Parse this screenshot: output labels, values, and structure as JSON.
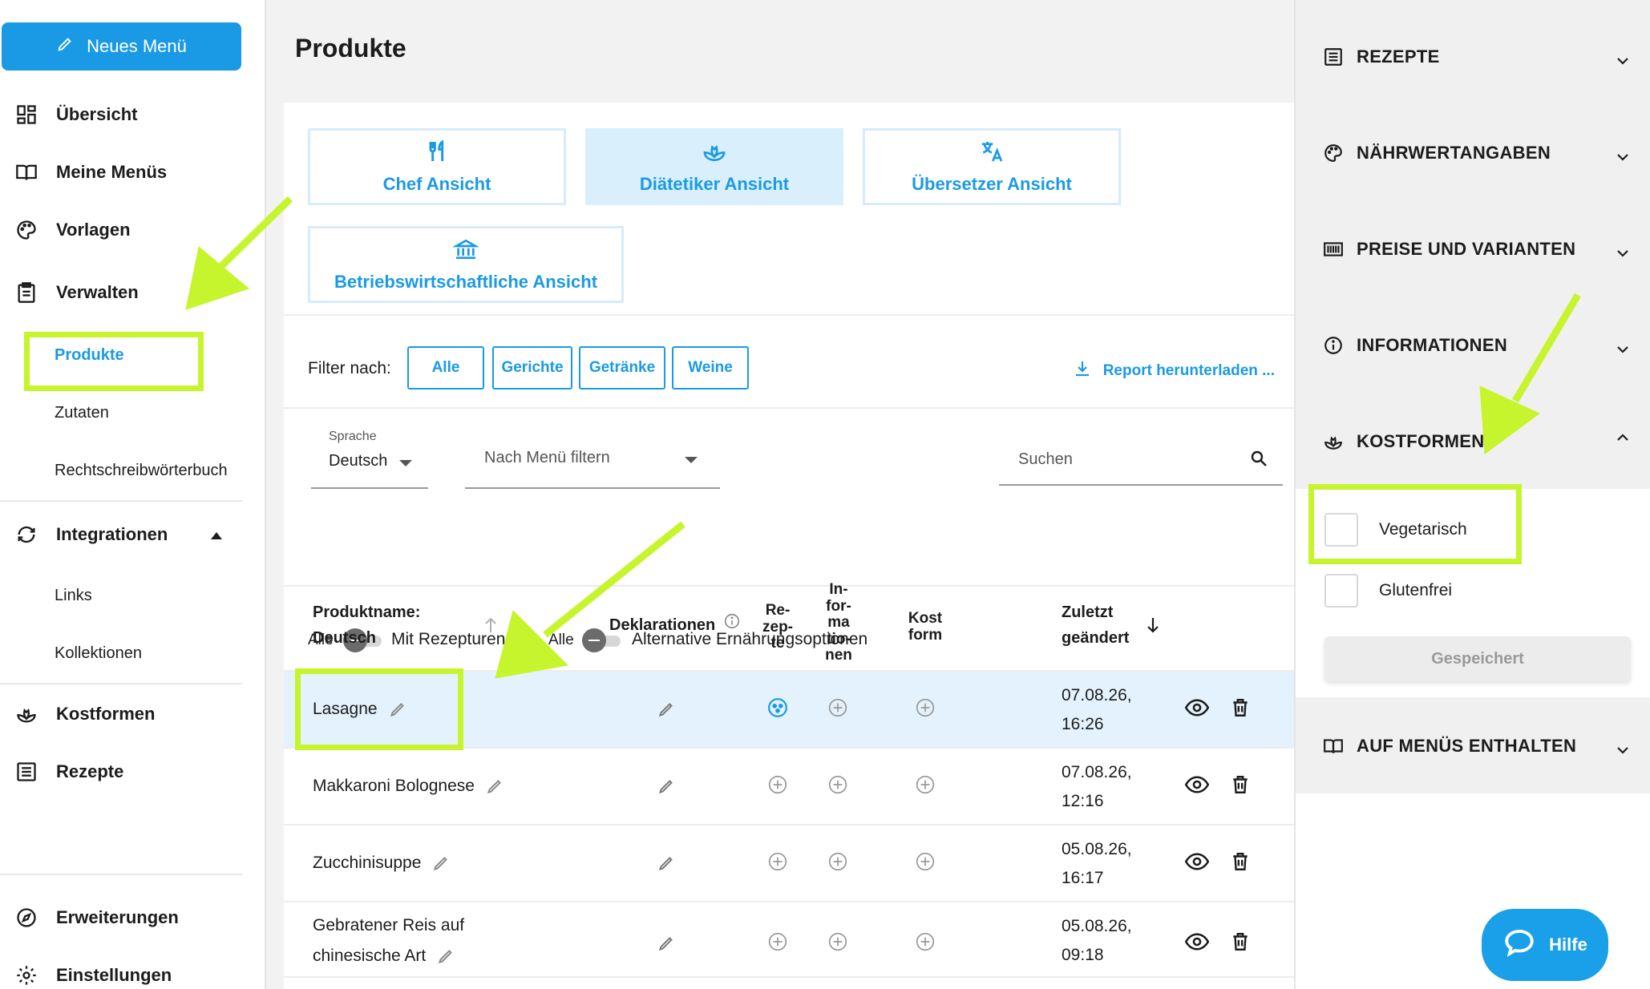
{
  "sidebar": {
    "new_menu": "Neues Menü",
    "items": [
      {
        "label": "Übersicht",
        "icon": "dashboard-icon"
      },
      {
        "label": "Meine Menüs",
        "icon": "book-icon"
      },
      {
        "label": "Vorlagen",
        "icon": "palette-icon"
      },
      {
        "label": "Verwalten",
        "icon": "clipboard-icon"
      }
    ],
    "manage_sub": [
      "Produkte",
      "Zutaten",
      "Rechtschreibwörterbuch"
    ],
    "integrations": {
      "label": "Integrationen",
      "icon": "sync-icon",
      "sub": [
        "Links",
        "Kollektionen"
      ]
    },
    "kostformen": {
      "label": "Kostformen",
      "icon": "lotus-icon"
    },
    "rezepte": {
      "label": "Rezepte",
      "icon": "list-icon"
    },
    "erweiterungen": {
      "label": "Erweiterungen",
      "icon": "compass-icon"
    },
    "einstellungen": {
      "label": "Einstellungen",
      "icon": "gear-icon"
    }
  },
  "main": {
    "title": "Produkte",
    "views": [
      {
        "label": "Chef Ansicht",
        "icon": "cutlery-icon"
      },
      {
        "label": "Diätetiker Ansicht",
        "icon": "lotus-icon",
        "active": true
      },
      {
        "label": "Übersetzer Ansicht",
        "icon": "translate-icon"
      },
      {
        "label": "Betriebswirtschaftliche Ansicht",
        "icon": "bank-icon"
      }
    ],
    "filter_label": "Filter nach:",
    "filters": [
      "Alle",
      "Gerichte",
      "Getränke",
      "Weine"
    ],
    "report": "Report herunterladen ...",
    "language_label": "Sprache",
    "language_value": "Deutsch",
    "menu_filter_placeholder": "Nach Menü filtern",
    "search_placeholder": "Suchen",
    "toggle1": {
      "left": "Alle",
      "right": "Mit Rezepturen"
    },
    "toggle2": {
      "left": "Alle",
      "right": "Alternative Ernährungsoptionen"
    },
    "columns": {
      "name_1": "Produktname:",
      "name_2": "Deutsch",
      "declarations": "Deklarationen",
      "recipe": [
        "Re-",
        "zep-",
        "te"
      ],
      "info": [
        "In-",
        "for-",
        "ma",
        "tio-",
        "nen"
      ],
      "diet": [
        "Kost",
        "form"
      ],
      "modified": [
        "Zuletzt",
        "geändert"
      ]
    },
    "rows": [
      {
        "name": "Lasagne",
        "date": "07.08.26,",
        "time": "16:26"
      },
      {
        "name": "Makkaroni Bolognese",
        "date": "07.08.26,",
        "time": "12:16"
      },
      {
        "name": "Zucchinisuppe",
        "date": "05.08.26,",
        "time": "16:17"
      },
      {
        "name_1": "Gebratener Reis auf",
        "name_2": "chinesische Art",
        "date": "05.08.26,",
        "time": "09:18"
      }
    ]
  },
  "right_panel": {
    "sections": [
      "REZEPTE",
      "NÄHRWERTANGABEN",
      "PREISE UND VARIANTEN",
      "INFORMATIONEN",
      "KOSTFORMEN",
      "AUF MENÜS ENTHALTEN"
    ],
    "diets": [
      "Vegetarisch",
      "Glutenfrei"
    ],
    "saved": "Gespeichert",
    "help": "Hilfe"
  },
  "colors": {
    "accent": "#1a9ae4",
    "highlight": "#c6f52d",
    "row_highlight": "#e3f2fc"
  }
}
